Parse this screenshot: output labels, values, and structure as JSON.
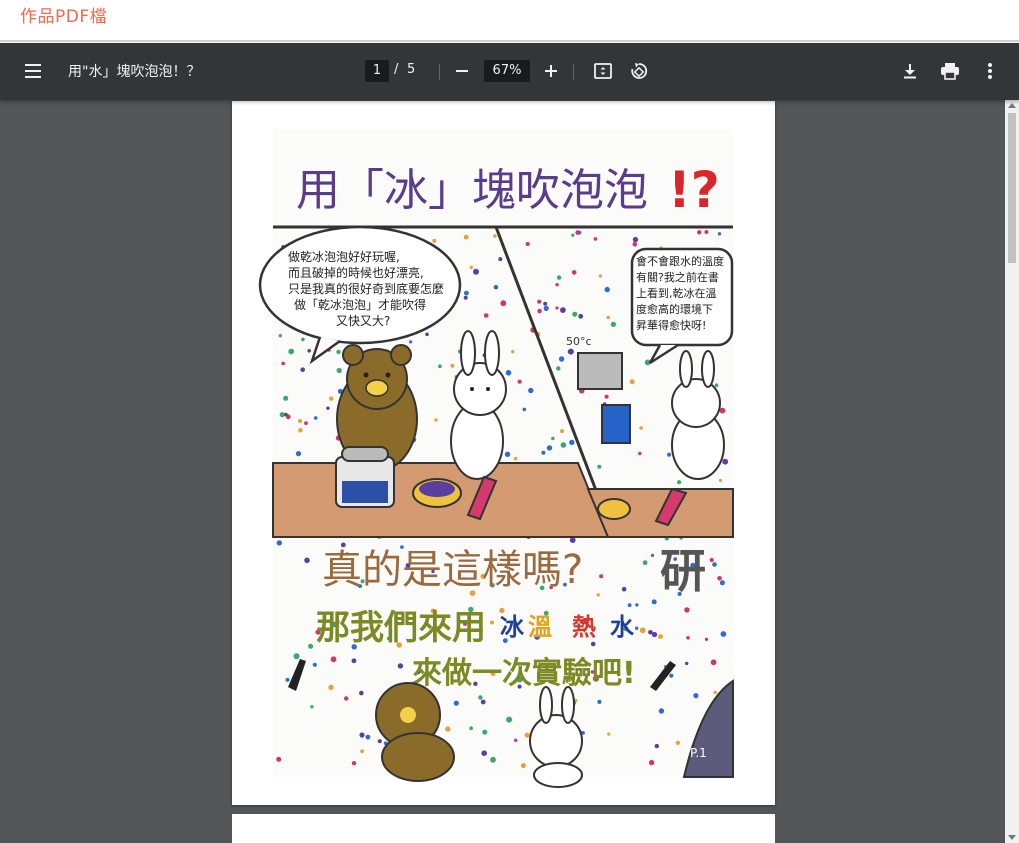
{
  "header": {
    "title": "作品PDF檔"
  },
  "toolbar": {
    "menu_icon": "hamburger-menu-icon",
    "doc_title": "用\"水」塊吹泡泡！？",
    "current_page": "1",
    "page_separator": "/",
    "total_pages": "5",
    "zoom": "67%",
    "icons": {
      "zoom_out": "minus-icon",
      "zoom_in": "plus-icon",
      "fit": "fit-page-icon",
      "rotate": "rotate-icon",
      "download": "download-icon",
      "print": "print-icon",
      "more": "more-vert-icon"
    }
  },
  "comic": {
    "title": "用「冰」塊吹泡泡",
    "title_marks": "!?",
    "bubble_left": [
      "做乾冰泡泡好好玩喔,",
      "而且破掉的時候也好漂亮,",
      "只是我真的很好奇到底要怎麼",
      "做「乾冰泡泡」才能吹得",
      "又快又大?"
    ],
    "bubble_right": [
      "會不會跟水的溫度",
      "有關?我之前在書",
      "上看到,乾冰在溫",
      "度愈高的環境下",
      "昇華得愈快呀!"
    ],
    "cube_label": "50°c",
    "middle_line": "真的是這樣嗎?",
    "stamp": "研",
    "line2_part1": "那我們來用",
    "line2_ice": "冰",
    "line2_warm": "溫",
    "line2_hot": "熱",
    "line2_water": "水",
    "line3": "來做一次實驗吧!",
    "page_mark": "P.1",
    "colors": {
      "title": "#5b3b8c",
      "marks": "#d9262b",
      "brown_text": "#9a6a3e",
      "olive_text": "#7b8a22",
      "ice_blue": "#1f3f9e",
      "warm_orange": "#e7a21c",
      "hot_red": "#d8362a",
      "counter": "#d49a72",
      "bear": "#8b6b2a"
    }
  }
}
